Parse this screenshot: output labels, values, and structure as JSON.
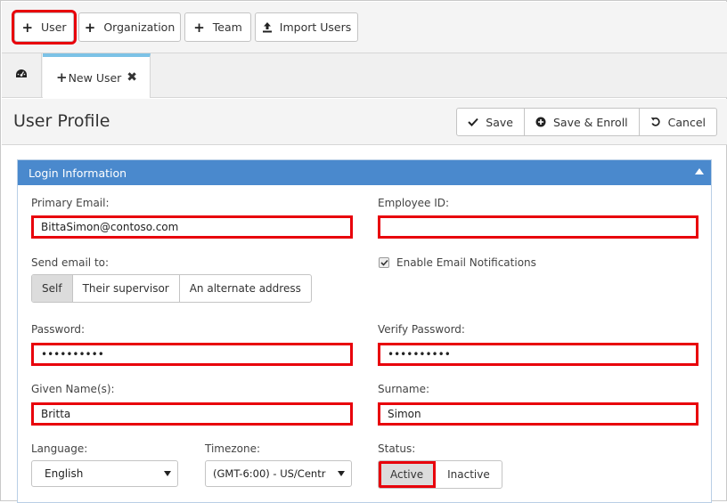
{
  "toolbar": {
    "user_label": "User",
    "organization_label": "Organization",
    "team_label": "Team",
    "import_label": "Import Users"
  },
  "tabs": {
    "new_user_label": "New User"
  },
  "header": {
    "title": "User Profile",
    "save_label": "Save",
    "save_enroll_label": "Save & Enroll",
    "cancel_label": "Cancel"
  },
  "login": {
    "section_title": "Login Information",
    "primary_email_label": "Primary Email:",
    "primary_email_value": "BittaSimon@contoso.com",
    "employee_id_label": "Employee ID:",
    "employee_id_value": "",
    "send_email_label": "Send email to:",
    "send_options": [
      "Self",
      "Their supervisor",
      "An alternate address"
    ],
    "send_selected": "Self",
    "notifications_label": "Enable Email Notifications",
    "notifications_checked": true,
    "password_label": "Password:",
    "password_value": "••••••••••",
    "verify_password_label": "Verify Password:",
    "verify_password_value": "••••••••••",
    "given_name_label": "Given Name(s):",
    "given_name_value": "Britta",
    "surname_label": "Surname:",
    "surname_value": "Simon",
    "language_label": "Language:",
    "language_value": "English",
    "timezone_label": "Timezone:",
    "timezone_value": "(GMT-6:00) - US/Centr",
    "status_label": "Status:",
    "status_options": [
      "Active",
      "Inactive"
    ],
    "status_selected": "Active"
  },
  "colors": {
    "highlight": "#e8000b",
    "panel_header": "#4a89cd",
    "tab_accent": "#7cc2e6"
  }
}
